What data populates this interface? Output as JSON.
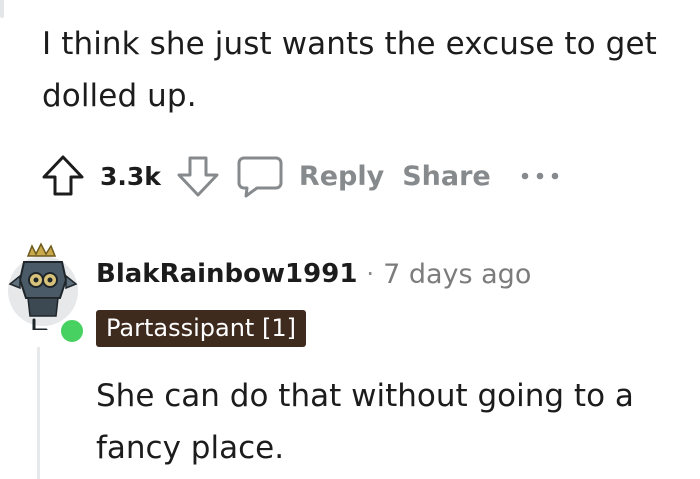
{
  "parent_comment": {
    "body": "I think she just wants the excuse to get dolled up.",
    "actions": {
      "upvote_icon": "arrow-up-outline-icon",
      "score": "3.3k",
      "downvote_icon": "arrow-down-outline-icon",
      "reply_icon": "speech-bubble-icon",
      "reply_label": "Reply",
      "share_label": "Share",
      "more_icon": "ellipsis-icon"
    }
  },
  "reply_comment": {
    "avatar_icon": "snoo-avatar-icon",
    "online_status_color": "#46d160",
    "username": "BlakRainbow1991",
    "separator": "·",
    "timestamp": "7 days ago",
    "flair": "Partassipant [1]",
    "flair_bg": "#3e2b1e",
    "body": "She can do that without going to a fancy place."
  },
  "colors": {
    "text": "#1c1c1c",
    "muted": "#878a8c",
    "background": "#ffffff"
  }
}
